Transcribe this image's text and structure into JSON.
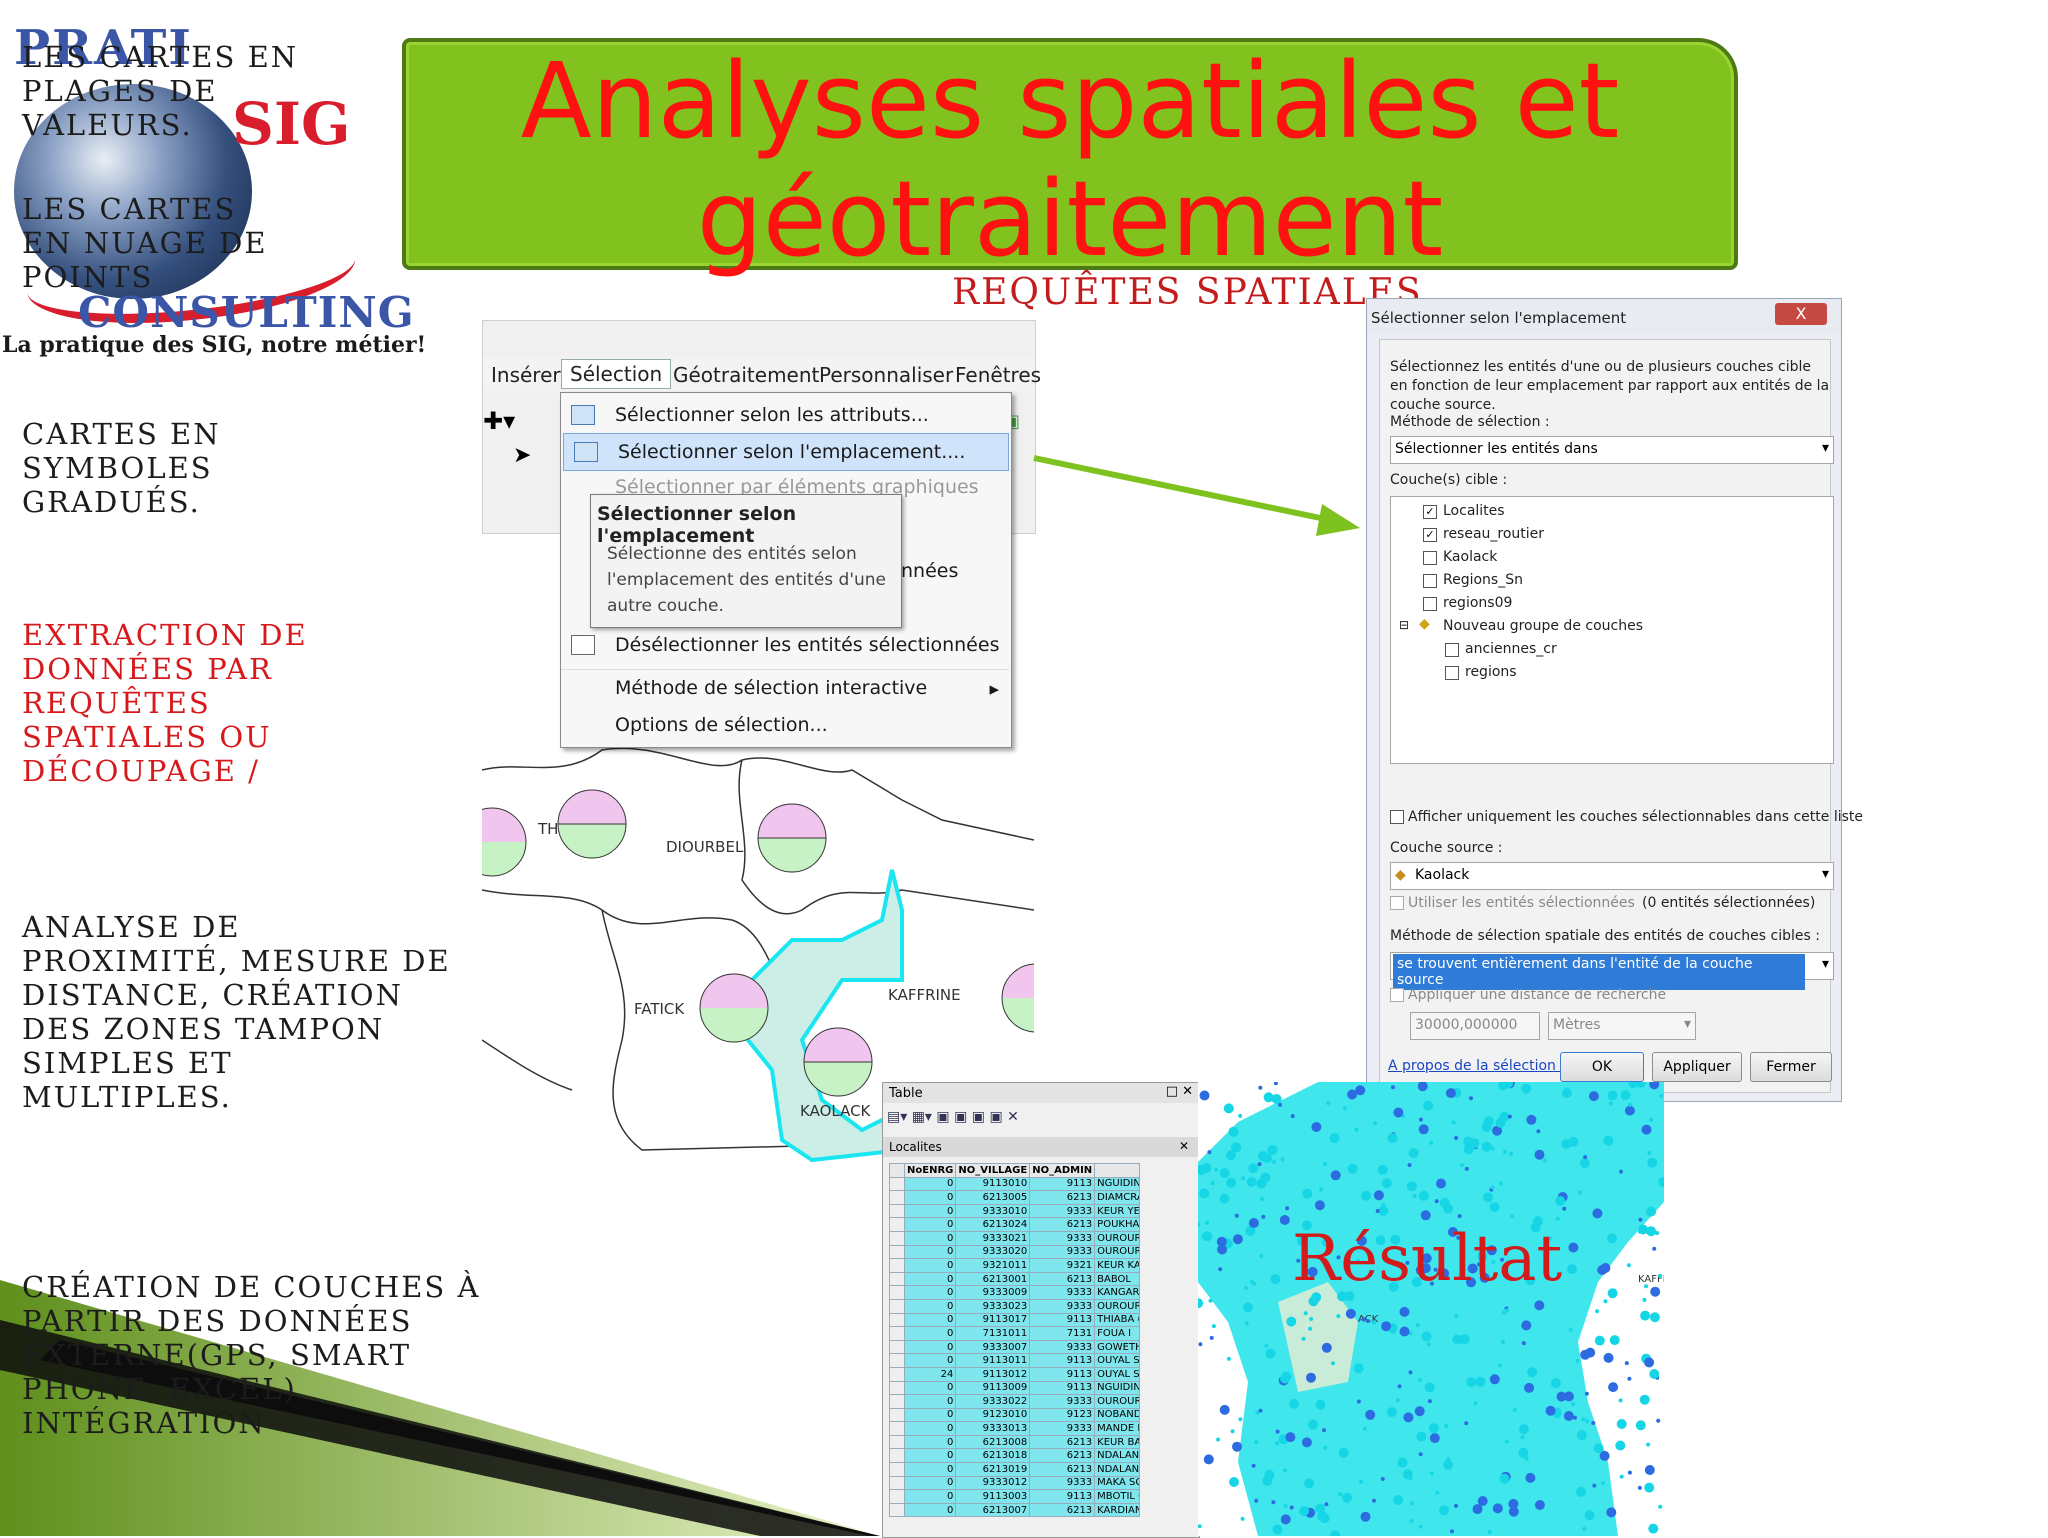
{
  "logo": {
    "brand_top": "PRATI",
    "brand_sig": "SIG",
    "brand_bottom": "CONSULTING",
    "tagline": "La pratique des SIG, notre métier!"
  },
  "left_bullets": [
    {
      "text": "Les cartes en plages de valeurs."
    },
    {
      "text": "Les cartes en nuage de points"
    },
    {
      "text": "Cartes en symboles gradués."
    },
    {
      "text": "Extraction de données par requêtes spatiales ou découpage /"
    },
    {
      "text": "Analyse de proximité, mesure de distance, création des zones tampon simples et multiples."
    },
    {
      "text": "Création de couches à partir des données externe(GPS, smart phone, Excel) Intégration"
    }
  ],
  "banner": {
    "title_line1": "Analyses spatiales et",
    "title_line2": "géotraitement",
    "colors": {
      "bg": "#81c21e",
      "text": "#ff1111"
    }
  },
  "subtitle": "Requêtes spatiales",
  "arcmap_menu": {
    "menubar": [
      "Insérer",
      "Sélection",
      "Géotraitement",
      "Personnaliser",
      "Fenêtres"
    ],
    "active": "Sélection",
    "items": [
      "Sélectionner selon les attributs...",
      "Sélectionner selon l'emplacement....",
      "Sélectionner par éléments graphiques",
      "Désélectionner les entités sélectionnées",
      "Méthode de sélection interactive",
      "Options de sélection..."
    ],
    "partial_item": "nnées",
    "tooltip_title": "Sélectionner selon l'emplacement",
    "tooltip_body": "Sélectionne des entités selon l'emplacement des entités d'une autre couche."
  },
  "dialog": {
    "title": "Sélectionner selon l'emplacement",
    "close_label": "X",
    "intro": "Sélectionnez les entités d'une ou de plusieurs couches cible en fonction de leur emplacement par rapport aux entités de la couche source.",
    "method_label": "Méthode de sélection :",
    "method_value": "Sélectionner les entités dans",
    "target_label": "Couche(s) cible :",
    "layers": [
      {
        "name": "Localites",
        "checked": true
      },
      {
        "name": "reseau_routier",
        "checked": true
      },
      {
        "name": "Kaolack",
        "checked": false
      },
      {
        "name": "Regions_Sn",
        "checked": false
      },
      {
        "name": "regions09",
        "checked": false
      }
    ],
    "group": {
      "name": "Nouveau groupe de couches",
      "children": [
        "anciennes_cr",
        "regions"
      ]
    },
    "only_selectable": "Afficher uniquement les couches sélectionnables dans cette liste",
    "source_label": "Couche source :",
    "source_value": "Kaolack",
    "use_selected": "Utiliser les entités sélectionnées",
    "selected_count": "(0 entités sélectionnées)",
    "spatial_method_label": "Méthode de sélection spatiale des entités de couches cibles :",
    "spatial_method_value": "se trouvent entièrement dans l'entité de la couche source",
    "apply_distance": "Appliquer une distance de recherche",
    "distance_value": "30000,000000",
    "distance_unit": "Mètres",
    "help_link": "A propos de la sélection selon",
    "ok": "OK",
    "apply": "Appliquer",
    "close": "Fermer"
  },
  "map_labels": [
    "THIES",
    "DIOURBEL",
    "FATICK",
    "KAFFRINE",
    "KAOLACK"
  ],
  "table": {
    "window_title": "Table",
    "layer_title": "Localites",
    "columns": [
      "NoENRG",
      "NO_VILLAGE",
      "NO_ADMIN",
      ""
    ],
    "rows": [
      [
        "0",
        "9113010",
        "9113",
        "NGUIDINE"
      ],
      [
        "0",
        "6213005",
        "6213",
        "DIAMCRA"
      ],
      [
        "0",
        "9333010",
        "9333",
        "KEUR YEF"
      ],
      [
        "0",
        "6213024",
        "6213",
        "POUKHAI"
      ],
      [
        "0",
        "9333021",
        "9333",
        "OUROUR"
      ],
      [
        "0",
        "9333020",
        "9333",
        "OUROUR"
      ],
      [
        "0",
        "9321011",
        "9321",
        "KEUR KAI"
      ],
      [
        "0",
        "6213001",
        "6213",
        "BABOL"
      ],
      [
        "0",
        "9333009",
        "9333",
        "KANGARI"
      ],
      [
        "0",
        "9333023",
        "9333",
        "OUROUR"
      ],
      [
        "0",
        "9113017",
        "9113",
        "THIABA (I"
      ],
      [
        "0",
        "7131011",
        "7131",
        "FOUA I"
      ],
      [
        "0",
        "9333007",
        "9333",
        "GOWETHI"
      ],
      [
        "0",
        "9113011",
        "9113",
        "OUYAL S"
      ],
      [
        "24",
        "9113012",
        "9113",
        "OUYAL S"
      ],
      [
        "0",
        "9113009",
        "9113",
        "NGUIDINE"
      ],
      [
        "0",
        "9333022",
        "9333",
        "OUROUR"
      ],
      [
        "0",
        "9123010",
        "9123",
        "NOBANDA"
      ],
      [
        "0",
        "9333013",
        "9333",
        "MANDE K"
      ],
      [
        "0",
        "6213008",
        "6213",
        "KEUR BAI"
      ],
      [
        "0",
        "6213018",
        "6213",
        "NDALANE"
      ],
      [
        "0",
        "6213019",
        "6213",
        "NDALANE"
      ],
      [
        "0",
        "9333012",
        "9333",
        "MAKA SC"
      ],
      [
        "0",
        "9113003",
        "9113",
        "MBOTIL C"
      ],
      [
        "0",
        "6213007",
        "6213",
        "KARDIAN"
      ]
    ]
  },
  "result": {
    "label": "Résultat",
    "map_labels": [
      "KAFFRINE",
      "ACK"
    ]
  }
}
